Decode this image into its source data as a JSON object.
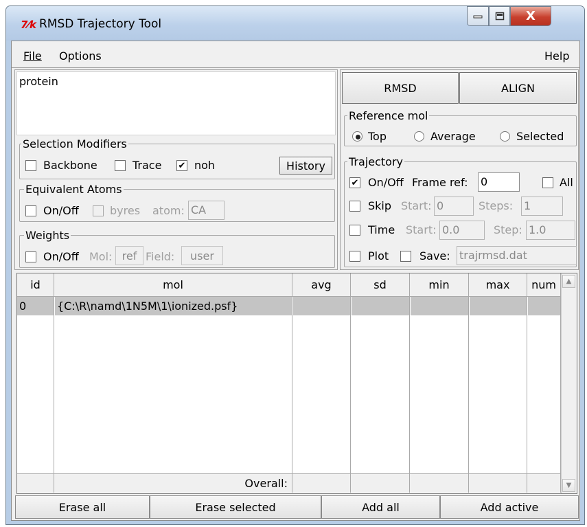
{
  "window": {
    "title": "RMSD Trajectory Tool",
    "icon": "tk-feather-icon",
    "minimize": "—",
    "maximize": "▢",
    "close": "X"
  },
  "menu": {
    "file": "File",
    "options": "Options",
    "help": "Help"
  },
  "selection_text": "protein",
  "actions": {
    "rmsd": "RMSD",
    "align": "ALIGN"
  },
  "selection_modifiers": {
    "title": "Selection Modifiers",
    "backbone": {
      "label": "Backbone",
      "checked": false
    },
    "trace": {
      "label": "Trace",
      "checked": false
    },
    "noh": {
      "label": "noh",
      "checked": true
    },
    "history": "History"
  },
  "equivalent_atoms": {
    "title": "Equivalent Atoms",
    "onoff": {
      "label": "On/Off",
      "checked": false
    },
    "byres": {
      "label": "byres",
      "checked": false
    },
    "atom_label": "atom:",
    "atom_value": "CA"
  },
  "weights": {
    "title": "Weights",
    "onoff": {
      "label": "On/Off",
      "checked": false
    },
    "mol_label": "Mol:",
    "mol_value": "ref",
    "field_label": "Field:",
    "field_value": "user"
  },
  "reference_mol": {
    "title": "Reference mol",
    "options": [
      "Top",
      "Average",
      "Selected"
    ],
    "selected": "Top"
  },
  "trajectory": {
    "title": "Trajectory",
    "onoff": {
      "label": "On/Off",
      "checked": true
    },
    "frame_ref_label": "Frame ref:",
    "frame_ref_value": "0",
    "all": {
      "label": "All",
      "checked": false
    },
    "skip": {
      "label": "Skip",
      "checked": false
    },
    "skip_start_label": "Start:",
    "skip_start_value": "0",
    "skip_steps_label": "Steps:",
    "skip_steps_value": "1",
    "time": {
      "label": "Time",
      "checked": false
    },
    "time_start_label": "Start:",
    "time_start_value": "0.0",
    "time_step_label": "Step:",
    "time_step_value": "1.0",
    "plot": {
      "label": "Plot",
      "checked": false
    },
    "save": {
      "label": "Save:",
      "checked": false
    },
    "save_file": "trajrmsd.dat"
  },
  "table": {
    "headers": [
      "id",
      "mol",
      "avg",
      "sd",
      "min",
      "max",
      "num"
    ],
    "rows": [
      {
        "id": "0",
        "mol": "{C:\\R\\namd\\1N5M\\1\\ionized.psf}",
        "avg": "",
        "sd": "",
        "min": "",
        "max": "",
        "num": ""
      }
    ],
    "overall_label": "Overall:"
  },
  "bottom_buttons": {
    "erase_all": "Erase all",
    "erase_selected": "Erase selected",
    "add_all": "Add all",
    "add_active": "Add active"
  }
}
